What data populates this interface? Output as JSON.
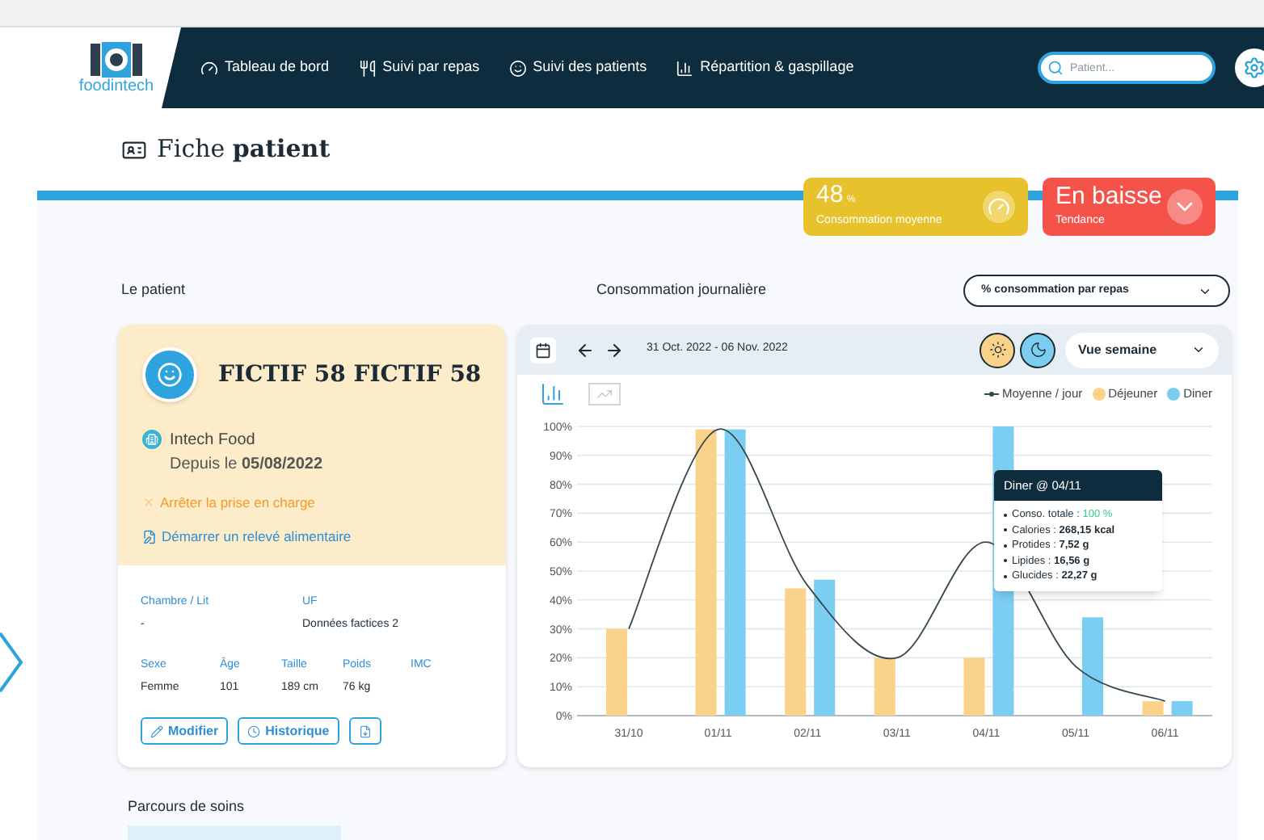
{
  "nav": {
    "logo": "foodintech",
    "items": [
      "Tableau de bord",
      "Suivi par repas",
      "Suivi des patients",
      "Répartition & gaspillage"
    ],
    "search": {
      "placeholder": "Patient..."
    }
  },
  "page_title": "Fiche **patient**",
  "kpis": [
    {
      "kind": "average",
      "value": "48",
      "unit": "%",
      "label": "Consommation moyenne"
    },
    {
      "kind": "trend",
      "value": "En baisse",
      "label": "Tendance"
    }
  ],
  "patient": {
    "section_title": "Le patient",
    "name": "FICTIF 58 **FICTIF 58**",
    "organisation": "Intech Food",
    "since": "Depuis le **05/08/2022**",
    "actions": [
      {
        "kind": "stop",
        "label": "Arrêter la prise en charge"
      },
      {
        "kind": "start",
        "label": "Démarrer un relevé alimentaire"
      }
    ],
    "fields_top": [
      {
        "label": "Chambre / Lit",
        "value": "-"
      },
      {
        "label": "UF",
        "value": "Données factices 2"
      }
    ],
    "fields_bottom": [
      {
        "label": "Sexe",
        "value": "Femme"
      },
      {
        "label": "Âge",
        "value": "101"
      },
      {
        "label": "Taille",
        "value": "189 cm"
      },
      {
        "label": "Poids",
        "value": "76 kg"
      },
      {
        "label": "IMC"
      }
    ],
    "buttons": [
      {
        "kind": "edit",
        "label": "Modifier"
      },
      {
        "kind": "history",
        "label": "Historique"
      },
      {
        "kind": "export"
      }
    ]
  },
  "consumption": {
    "section_title": "Consommation journalière",
    "metric_select": "% consommation par repas",
    "date_range": "31 Oct. 2022 - 06 Nov. 2022",
    "meal_filters": [
      {
        "kind": "lunch",
        "on": true
      },
      {
        "kind": "dinner",
        "on": true
      }
    ],
    "view_select": "Vue semaine",
    "view_toggle": [
      {
        "kind": "bar",
        "selected": true
      },
      {
        "kind": "line",
        "selected": false
      }
    ],
    "chart_data": {
      "type": "bar",
      "categories": [
        "31/10",
        "01/11",
        "02/11",
        "03/11",
        "04/11",
        "05/11",
        "06/11"
      ],
      "series": [
        {
          "name": "Moyenne / jour",
          "type": "line",
          "color": "#37474f",
          "values": [
            30,
            99,
            45,
            20,
            60,
            17,
            5
          ]
        },
        {
          "name": "Déjeuner",
          "type": "bar",
          "color": "#fbd28a",
          "values": [
            30,
            99,
            44,
            20,
            20,
            null,
            5
          ]
        },
        {
          "name": "Diner",
          "type": "bar",
          "color": "#7ccdf2",
          "values": [
            null,
            99,
            47,
            null,
            100,
            34,
            5
          ]
        }
      ],
      "grid": true,
      "ylim": [
        0,
        100
      ],
      "yticks": [
        {
          "value": 0,
          "label": "0%"
        },
        {
          "value": 10,
          "label": "10%"
        },
        {
          "value": 20,
          "label": "20%"
        },
        {
          "value": 30,
          "label": "30%"
        },
        {
          "value": 40,
          "label": "40%"
        },
        {
          "value": 50,
          "label": "50%"
        },
        {
          "value": 60,
          "label": "60%"
        },
        {
          "value": 70,
          "label": "70%"
        },
        {
          "value": 80,
          "label": "80%"
        },
        {
          "value": 90,
          "label": "90%"
        },
        {
          "value": 100,
          "label": "100%"
        }
      ]
    },
    "tooltip": {
      "title": "Diner @ 04/11",
      "items": [
        {
          "label": "Conso. totale :",
          "value": "100 %",
          "kind": "highlight"
        },
        {
          "label": "Calories :",
          "value": "268,15 kcal",
          "kind": "bold"
        },
        {
          "label": "Protides :",
          "value": "7,52 g",
          "kind": "bold"
        },
        {
          "label": "Lipides :",
          "value": "16,56 g",
          "kind": "bold"
        },
        {
          "label": "Glucides :",
          "value": "22,27 g",
          "kind": "bold"
        }
      ]
    }
  },
  "care_path": {
    "title": "Parcours de soins"
  }
}
